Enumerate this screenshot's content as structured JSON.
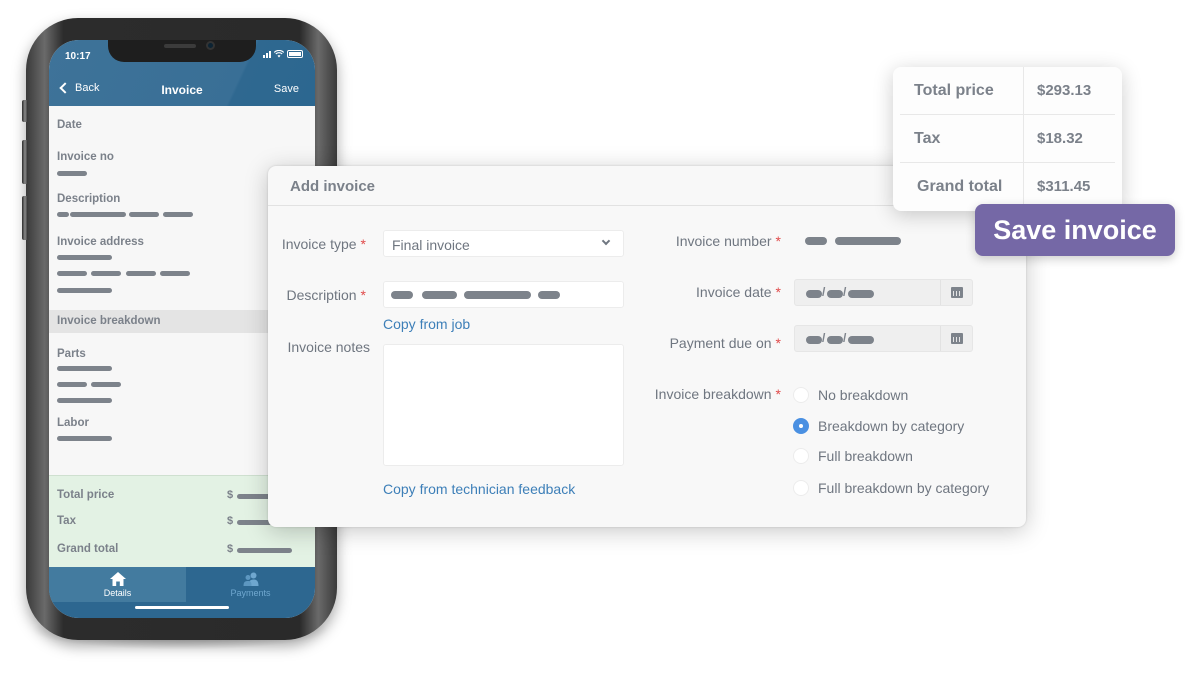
{
  "phone": {
    "status_time": "10:17",
    "header": {
      "back_label": "Back",
      "title": "Invoice",
      "save_label": "Save"
    },
    "fields": {
      "date_label": "Date",
      "invoice_no_label": "Invoice no",
      "description_label": "Description",
      "invoice_address_label": "Invoice address"
    },
    "breakdown_section_label": "Invoice breakdown",
    "breakdown": {
      "parts_label": "Parts",
      "labor_label": "Labor"
    },
    "totals": {
      "total_price_label": "Total price",
      "tax_label": "Tax",
      "grand_total_label": "Grand total",
      "currency_symbol": "$"
    },
    "tabs": [
      {
        "label": "Details",
        "icon": "home-icon",
        "active": true
      },
      {
        "label": "Payments",
        "icon": "users-icon",
        "active": false
      }
    ]
  },
  "dialog": {
    "title": "Add invoice",
    "required_marker": "*",
    "invoice_type": {
      "label": "Invoice type",
      "value": "Final invoice"
    },
    "description": {
      "label": "Description",
      "copy_link": "Copy from job"
    },
    "invoice_notes": {
      "label": "Invoice notes",
      "value": "",
      "copy_link": "Copy from technician feedback"
    },
    "invoice_number": {
      "label": "Invoice number"
    },
    "invoice_date": {
      "label": "Invoice date",
      "separator": "/"
    },
    "payment_due_on": {
      "label": "Payment due on",
      "separator": "/"
    },
    "invoice_breakdown": {
      "label": "Invoice breakdown",
      "options": [
        {
          "label": "No breakdown",
          "selected": false
        },
        {
          "label": "Breakdown by category",
          "selected": true
        },
        {
          "label": "Full breakdown",
          "selected": false
        },
        {
          "label": "Full breakdown by category",
          "selected": false
        }
      ]
    }
  },
  "totals_card": {
    "rows": [
      {
        "label": "Total price",
        "value": "$293.13"
      },
      {
        "label": "Tax",
        "value": "$18.32"
      },
      {
        "label": "Grand total",
        "value": "$311.45"
      }
    ]
  },
  "save_invoice_button": {
    "label": "Save invoice"
  },
  "colors": {
    "phone_header": "#396f96",
    "accent_link": "#3d7fb8",
    "radio_selected": "#4a90e2",
    "save_button": "#7568a6",
    "totals_band": "#e3f2e4",
    "required": "#e04a4a"
  }
}
